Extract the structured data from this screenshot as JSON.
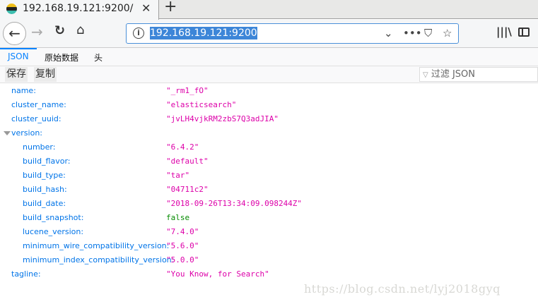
{
  "browser": {
    "tab_title": "192.168.19.121:9200/",
    "url": "192.168.19.121:9200"
  },
  "viewer": {
    "tabs": [
      {
        "label": "JSON"
      },
      {
        "label": "原始数据"
      },
      {
        "label": "头"
      }
    ],
    "toolbar": {
      "save": "保存",
      "copy": "复制",
      "filter_placeholder": "过滤 JSON"
    },
    "rows": [
      {
        "key": "name:",
        "value": "\"_rm1_fO\""
      },
      {
        "key": "cluster_name:",
        "value": "\"elasticsearch\""
      },
      {
        "key": "cluster_uuid:",
        "value": "\"jvLH4vjkRM2zbS7Q3adJIA\""
      },
      {
        "key": "version:",
        "value": ""
      },
      {
        "key": "number:",
        "value": "\"6.4.2\""
      },
      {
        "key": "build_flavor:",
        "value": "\"default\""
      },
      {
        "key": "build_type:",
        "value": "\"tar\""
      },
      {
        "key": "build_hash:",
        "value": "\"04711c2\""
      },
      {
        "key": "build_date:",
        "value": "\"2018-09-26T13:34:09.098244Z\""
      },
      {
        "key": "build_snapshot:",
        "value": "false"
      },
      {
        "key": "lucene_version:",
        "value": "\"7.4.0\""
      },
      {
        "key": "minimum_wire_compatibility_version:",
        "value": "\"5.6.0\""
      },
      {
        "key": "minimum_index_compatibility_version:",
        "value": "\"5.0.0\""
      },
      {
        "key": "tagline:",
        "value": "\"You Know, for Search\""
      }
    ]
  },
  "watermark": "https://blog.csdn.net/lyj2018gyq"
}
